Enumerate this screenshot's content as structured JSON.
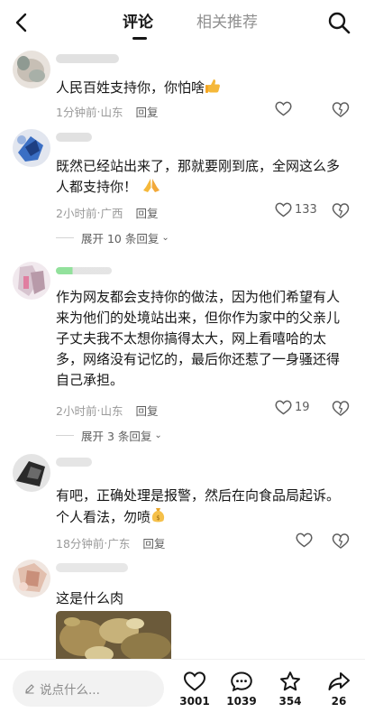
{
  "header": {
    "tabs": [
      {
        "label": "评论",
        "active": true
      },
      {
        "label": "相关推荐",
        "active": false
      }
    ]
  },
  "comments": [
    {
      "text": "人民百姓支持你，你怕啥",
      "time": "1分钟前",
      "location": "山东",
      "reply_label": "回复",
      "likes": "",
      "emoji_icon": "thumbs-up"
    },
    {
      "text": "既然已经站出来了，那就要刚到底，全网这么多人都支持你！",
      "time": "2小时前",
      "location": "广西",
      "reply_label": "回复",
      "likes": "133",
      "expand_label": "展开 10 条回复",
      "emoji_icon": "praying-hands"
    },
    {
      "text": "作为网友都会支持你的做法，因为他们希望有人来为他们的处境站出来，但你作为家中的父亲儿子丈夫我不太想你搞得太大，网上看嘻哈的太多，网络没有记忆的，最后你还惹了一身骚还得自己承担。",
      "time": "2小时前",
      "location": "山东",
      "reply_label": "回复",
      "likes": "19",
      "expand_label": "展开 3 条回复"
    },
    {
      "text": "有吧，正确处理是报警，然后在向食品局起诉。个人看法，勿喷",
      "time": "18分钟前",
      "location": "广东",
      "reply_label": "回复",
      "likes": "",
      "emoji_icon": "money-bag"
    },
    {
      "text": "这是什么肉",
      "image": "meat-photo"
    }
  ],
  "meta_separator": " · ",
  "bottom_bar": {
    "input_placeholder": "说点什么...",
    "likes_count": "3001",
    "comments_count": "1039",
    "favorites_count": "354",
    "shares_count": "26"
  },
  "colors": {
    "text": "#161616",
    "secondary": "#9a9a9a",
    "input_bg": "#f2f2f2",
    "emoji_yellow": "#f5b83a"
  }
}
